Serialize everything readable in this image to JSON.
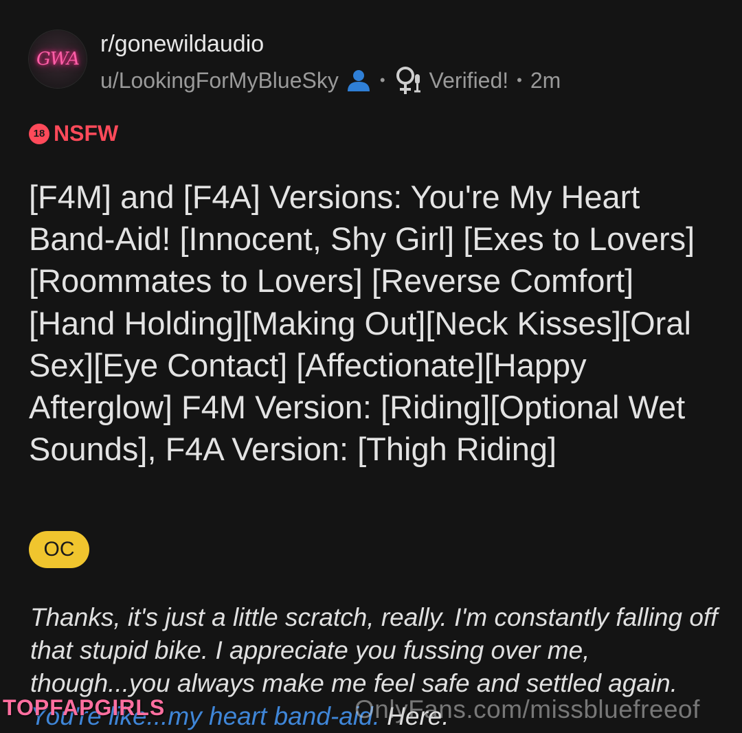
{
  "header": {
    "avatar_text": "GWA",
    "subreddit": "r/gonewildaudio",
    "username": "u/LookingForMyBlueSky",
    "separator": "•",
    "verified_label": "Verified!",
    "time_ago": "2m",
    "icons": [
      "user-icon",
      "female-mic-icon"
    ]
  },
  "nsfw": {
    "badge": "18",
    "label": "NSFW"
  },
  "post": {
    "title": "[F4M] and [F4A] Versions: You're My Heart Band-Aid! [Innocent, Shy Girl] [Exes to Lovers][Roommates to Lovers] [Reverse Comfort][Hand Holding][Making Out][Neck Kisses][Oral Sex][Eye Contact] [Affectionate][Happy Afterglow] F4M Version: [Riding][Optional Wet Sounds], F4A Version: [Thigh Riding]",
    "flair": "OC",
    "body_start": "Thanks, it's just a little scratch, really. I'm constantly falling off that stupid bike. I appreciate you fussing over me, though...you always make me feel safe and settled again. ",
    "body_link": "You're like...my heart band-aid.",
    "body_end": " Here."
  },
  "watermarks": {
    "left": "TOPFAPGIRLS",
    "right": "OnlyFans.com/missbluefreeof"
  },
  "colors": {
    "background": "#141414",
    "nsfw": "#ff4a5a",
    "flair": "#f0c52e",
    "link": "#3f86d8",
    "user_icon": "#2f7fd6"
  }
}
